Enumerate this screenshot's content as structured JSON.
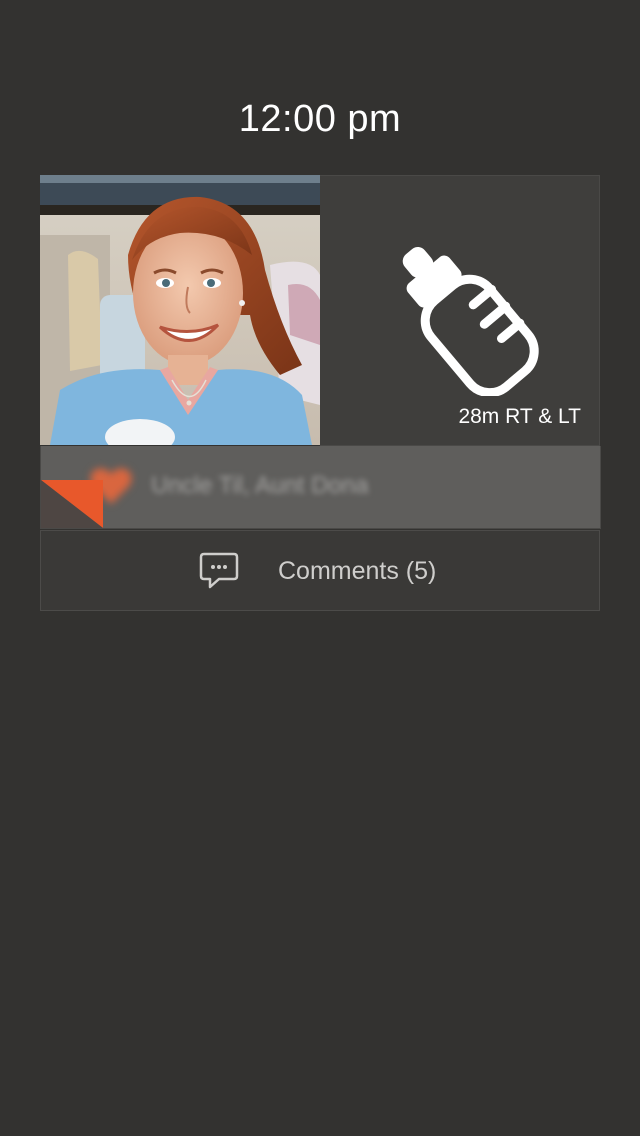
{
  "header": {
    "time": "12:00 pm"
  },
  "entry": {
    "feeding": {
      "icon": "baby-bottle-icon",
      "label": "28m RT & LT"
    },
    "author": {
      "icon": "heart-icon",
      "name": "Uncle Til, Aunt Dona"
    },
    "comments": {
      "icon": "speech-bubble-icon",
      "label": "Comments (5)"
    }
  },
  "colors": {
    "background": "#333230",
    "tile": "#3f3e3c",
    "author_bar": "#5f5e5c",
    "accent": "#e8582b"
  }
}
